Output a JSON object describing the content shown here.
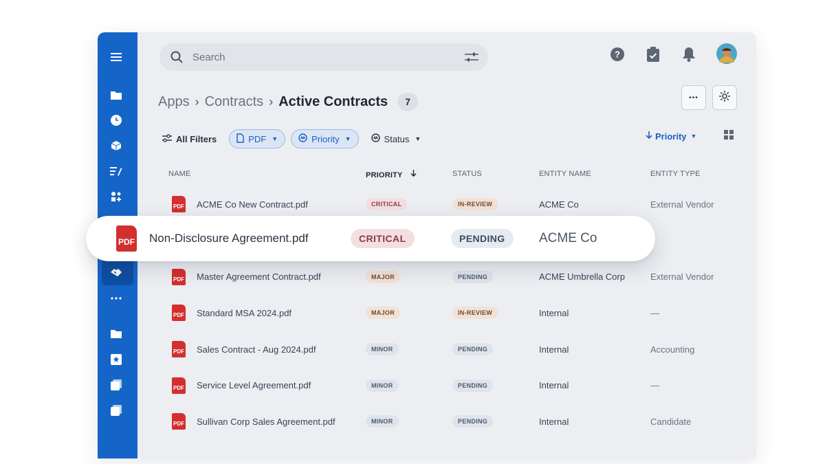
{
  "search": {
    "placeholder": "Search"
  },
  "breadcrumb": {
    "items": [
      "Apps",
      "Contracts"
    ],
    "current": "Active Contracts",
    "count": "7"
  },
  "filters": {
    "all": "All Filters",
    "chips": [
      {
        "label": "PDF",
        "active": true
      },
      {
        "label": "Priority",
        "active": true
      },
      {
        "label": "Status",
        "active": false
      }
    ]
  },
  "sort": {
    "label": "Priority"
  },
  "table": {
    "columns": [
      "NAME",
      "PRIORITY",
      "STATUS",
      "ENTITY NAME",
      "ENTITY TYPE"
    ],
    "rows": [
      {
        "name": "ACME Co New Contract.pdf",
        "priority": "CRITICAL",
        "status": "IN-REVIEW",
        "entity": "ACME Co",
        "type": "External Vendor"
      },
      {
        "name": "Master Agreement Contract.pdf",
        "priority": "MAJOR",
        "status": "PENDING",
        "entity": "ACME Umbrella Corp",
        "type": "External Vendor"
      },
      {
        "name": "Standard MSA 2024.pdf",
        "priority": "MAJOR",
        "status": "IN-REVIEW",
        "entity": "Internal",
        "type": "—"
      },
      {
        "name": "Sales Contract - Aug 2024.pdf",
        "priority": "MINOR",
        "status": "PENDING",
        "entity": "Internal",
        "type": "Accounting"
      },
      {
        "name": "Service Level Agreement.pdf",
        "priority": "MINOR",
        "status": "PENDING",
        "entity": "Internal",
        "type": "—"
      },
      {
        "name": "Sullivan Corp Sales Agreement.pdf",
        "priority": "MINOR",
        "status": "PENDING",
        "entity": "Internal",
        "type": "Candidate"
      }
    ]
  },
  "highlight": {
    "file_badge": "PDF",
    "name": "Non-Disclosure Agreement.pdf",
    "priority": "CRITICAL",
    "status": "PENDING",
    "entity": "ACME Co"
  },
  "file_badge": "PDF",
  "more_label": "•••",
  "colors": {
    "brand": "#1565c8",
    "pdf": "#d32f2f",
    "accent": "#1a5fc2"
  }
}
